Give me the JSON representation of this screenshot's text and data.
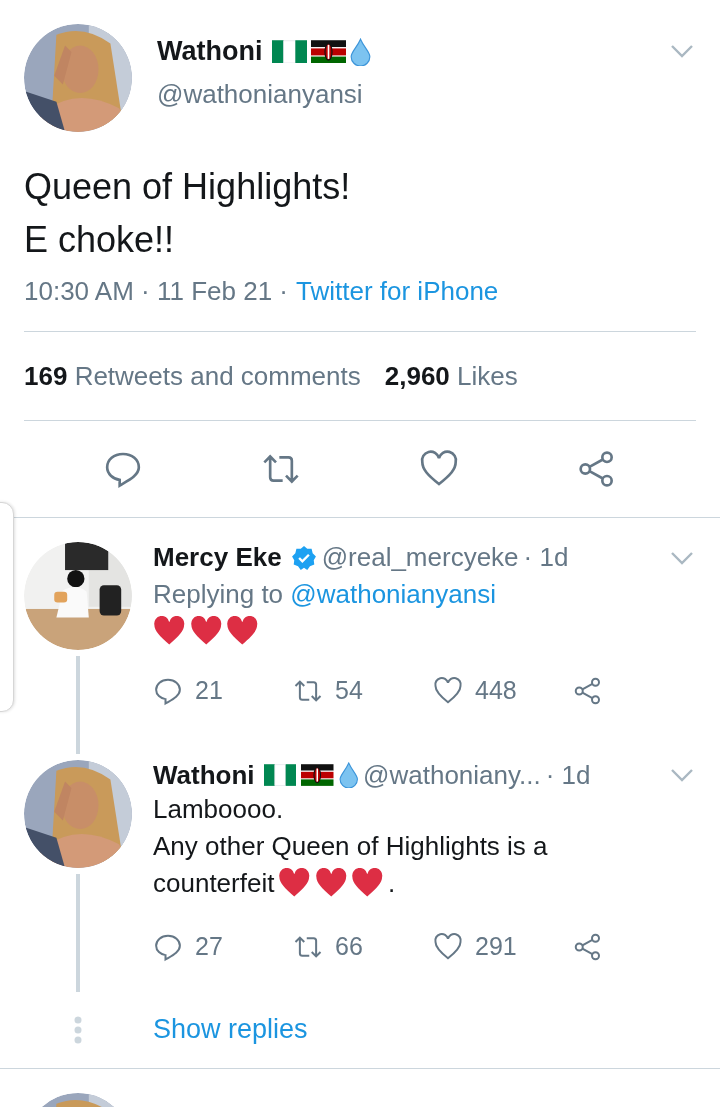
{
  "tweet": {
    "name": "Wathoni",
    "emojis": [
      {
        "kind": "nigeria-flag"
      },
      {
        "kind": "kenya-flag"
      },
      {
        "kind": "droplet"
      }
    ],
    "handle": "@wathonianyansi",
    "lines": [
      "Queen of Highlights!",
      "E choke!!"
    ],
    "meta": "10:30 AM · 11 Feb 21 ·",
    "source": "Twitter for iPhone",
    "stats": [
      {
        "count": "169",
        "label": "Retweets and comments"
      },
      {
        "count": "2,960",
        "label": "Likes"
      }
    ]
  },
  "replies": [
    {
      "name": "Mercy Eke",
      "verified": true,
      "handle": "@real_mercyeke",
      "age": "· 1d",
      "replying_prefix": "Replying to",
      "replying_handle": "@wathonianyansi",
      "body": [
        [
          {
            "kind": "heart"
          },
          {
            "kind": "heart"
          },
          {
            "kind": "heart"
          }
        ]
      ],
      "replies": "21",
      "retweets": "54",
      "likes": "448"
    },
    {
      "name": "Wathoni",
      "verified": false,
      "emojis": [
        {
          "kind": "nigeria-flag"
        },
        {
          "kind": "kenya-flag"
        },
        {
          "kind": "droplet"
        }
      ],
      "handle": "@wathoniany...",
      "age": "· 1d",
      "body": [
        [
          {
            "kind": "text",
            "text": "Lamboooo."
          }
        ],
        [
          {
            "kind": "text",
            "text": "Any other Queen of Highlights is a"
          }
        ],
        [
          {
            "kind": "text",
            "text": "counterfeit"
          },
          {
            "kind": "heart"
          },
          {
            "kind": "heart"
          },
          {
            "kind": "heart"
          },
          {
            "kind": "text",
            "text": "."
          }
        ]
      ],
      "replies": "27",
      "retweets": "66",
      "likes": "291"
    }
  ],
  "show_replies": "Show replies"
}
